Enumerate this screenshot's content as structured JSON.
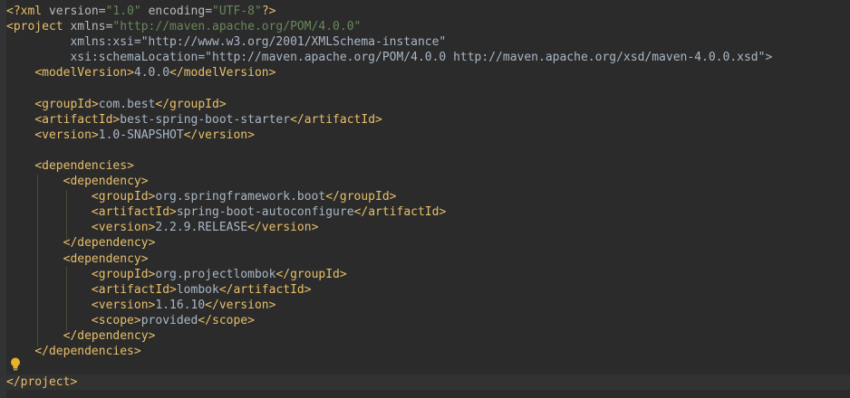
{
  "editor": {
    "language": "xml",
    "colors": {
      "background": "#2b2b2b",
      "tag": "#e8bf6a",
      "attribute": "#bababa",
      "attribute_value": "#6a8759",
      "namespace": "#9876aa",
      "text": "#a9b7c6",
      "punctuation": "#cc7832"
    },
    "gutter_icon": "lightbulb-icon",
    "lines": [
      "<?xml version=\"1.0\" encoding=\"UTF-8\"?>",
      "<project xmlns=\"http://maven.apache.org/POM/4.0.0\"",
      "         xmlns:xsi=\"http://www.w3.org/2001/XMLSchema-instance\"",
      "         xsi:schemaLocation=\"http://maven.apache.org/POM/4.0.0 http://maven.apache.org/xsd/maven-4.0.0.xsd\">",
      "    <modelVersion>4.0.0</modelVersion>",
      "",
      "    <groupId>com.best</groupId>",
      "    <artifactId>best-spring-boot-starter</artifactId>",
      "    <version>1.0-SNAPSHOT</version>",
      "",
      "    <dependencies>",
      "        <dependency>",
      "            <groupId>org.springframework.boot</groupId>",
      "            <artifactId>spring-boot-autoconfigure</artifactId>",
      "            <version>2.2.9.RELEASE</version>",
      "        </dependency>",
      "        <dependency>",
      "            <groupId>org.projectlombok</groupId>",
      "            <artifactId>lombok</artifactId>",
      "            <version>1.16.10</version>",
      "            <scope>provided</scope>",
      "        </dependency>",
      "    </dependencies>",
      "",
      "</project>"
    ]
  }
}
